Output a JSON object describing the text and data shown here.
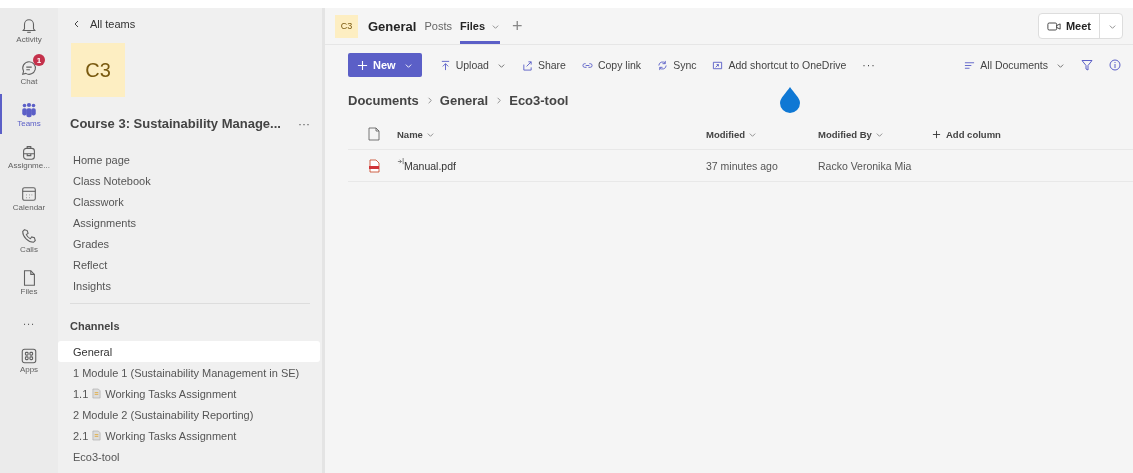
{
  "rail": [
    {
      "label": "Activity",
      "kind": "bell",
      "selected": false
    },
    {
      "label": "Chat",
      "kind": "chat",
      "selected": false,
      "badge": "1"
    },
    {
      "label": "Teams",
      "kind": "teams",
      "selected": true
    },
    {
      "label": "Assignme...",
      "kind": "bag",
      "selected": false
    },
    {
      "label": "Calendar",
      "kind": "calendar",
      "selected": false
    },
    {
      "label": "Calls",
      "kind": "phone",
      "selected": false
    },
    {
      "label": "Files",
      "kind": "file",
      "selected": false
    },
    {
      "label": "...",
      "kind": "more",
      "selected": false
    },
    {
      "label": "Apps",
      "kind": "apps",
      "selected": false
    }
  ],
  "sidebar": {
    "back": "All teams",
    "avatar": "C3",
    "team_name": "Course 3: Sustainability Manage...",
    "more": "···",
    "items": [
      "Home page",
      "Class Notebook",
      "Classwork",
      "Assignments",
      "Grades",
      "Reflect",
      "Insights"
    ],
    "channels_heading": "Channels",
    "channels": [
      {
        "kind": "channel",
        "label": "General",
        "selected": true
      },
      {
        "kind": "channel",
        "label": "1 Module 1 (Sustainability Management in SE)",
        "selected": false
      },
      {
        "kind": "assignment",
        "number": "1.1",
        "title": "Working Tasks Assignment",
        "selected": false
      },
      {
        "kind": "channel",
        "label": "2 Module 2 (Sustainability Reporting)",
        "selected": false
      },
      {
        "kind": "assignment",
        "number": "2.1",
        "title": "Working Tasks Assignment",
        "selected": false
      },
      {
        "kind": "channel",
        "label": "Eco3-tool",
        "selected": false
      }
    ]
  },
  "header": {
    "avatar": "C3",
    "channel": "General",
    "tabs": [
      {
        "label": "Posts",
        "selected": false,
        "caret": false
      },
      {
        "label": "Files",
        "selected": true,
        "caret": true
      }
    ],
    "add": "+",
    "meet": "Meet"
  },
  "toolbar": {
    "new": "New",
    "actions": [
      {
        "label": "Upload",
        "kind": "upload",
        "caret": true
      },
      {
        "label": "Share",
        "kind": "share",
        "caret": false
      },
      {
        "label": "Copy link",
        "kind": "link",
        "caret": false
      },
      {
        "label": "Sync",
        "kind": "sync",
        "caret": false
      },
      {
        "label": "Add shortcut to OneDrive",
        "kind": "shortcut",
        "caret": false
      }
    ],
    "more": "···",
    "view": "All Documents"
  },
  "breadcrumb": [
    "Documents",
    "General",
    "Eco3-tool"
  ],
  "table": {
    "columns": [
      "Name",
      "Modified",
      "Modified By"
    ],
    "add_column": "Add column",
    "rows": [
      {
        "name": "Manual.pdf",
        "modified": "37 minutes ago",
        "modified_by": "Racko Veronika Mia"
      }
    ]
  }
}
